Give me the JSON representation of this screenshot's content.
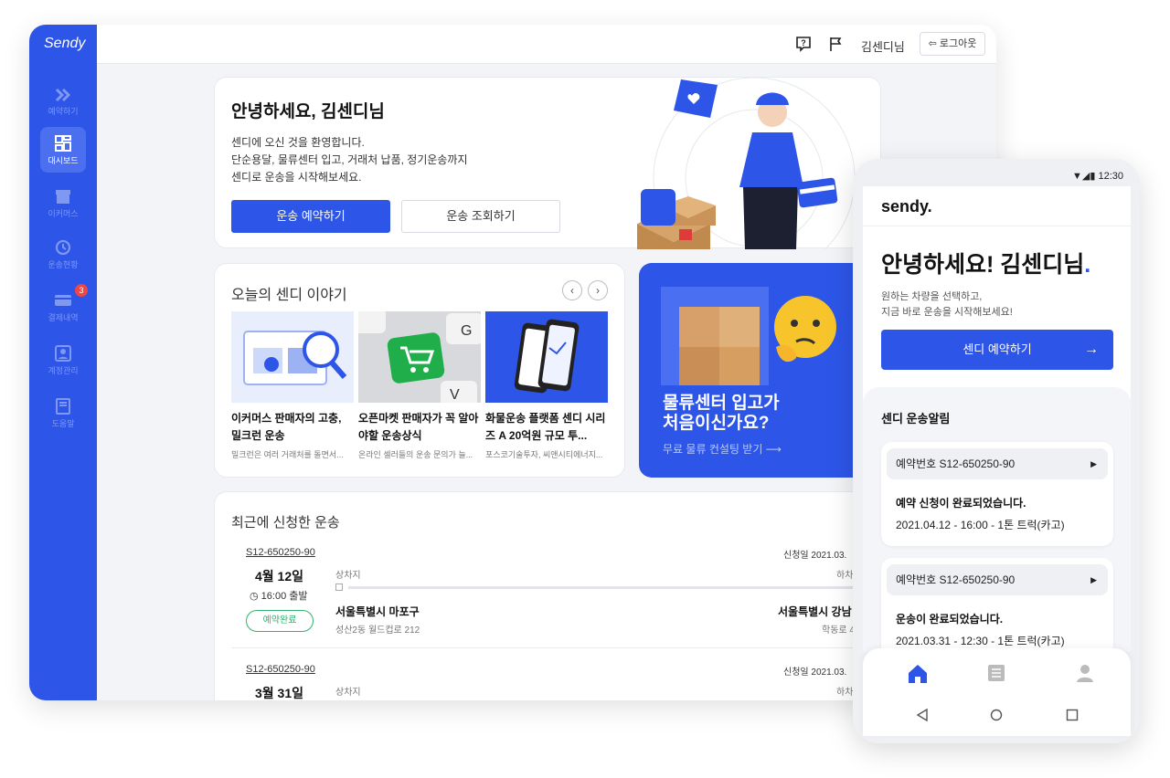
{
  "desktop": {
    "logo": "Sendy",
    "sidebar": [
      {
        "icon": "double-chevron-icon",
        "label": "예약하기",
        "active": false,
        "badge": ""
      },
      {
        "icon": "dashboard-icon",
        "label": "대시보드",
        "active": true,
        "badge": ""
      },
      {
        "icon": "store-icon",
        "label": "이커머스",
        "active": false,
        "badge": ""
      },
      {
        "icon": "history-icon",
        "label": "운송현황",
        "active": false,
        "badge": ""
      },
      {
        "icon": "card-icon",
        "label": "결제내역",
        "active": false,
        "badge": "3"
      },
      {
        "icon": "account-icon",
        "label": "계정관리",
        "active": false,
        "badge": ""
      },
      {
        "icon": "help-book-icon",
        "label": "도움말",
        "active": false,
        "badge": ""
      }
    ],
    "topbar": {
      "user": "김센디님",
      "logout": "로그아웃"
    },
    "hello": {
      "title": "안녕하세요, 김센디님",
      "line1": "센디에 오신 것을 환영합니다.",
      "line2": "단순용달, 물류센터 입고, 거래처 납품, 정기운송까지",
      "line3": "센디로 운송을 시작해보세요.",
      "primary": "운송 예약하기",
      "secondary": "운송 조회하기"
    },
    "story": {
      "title": "오늘의 센디 이야기",
      "items": [
        {
          "title": "이커머스 판매자의 고충, 밀크런 운송",
          "summary": "밀크런은 여러 거래처를 돌면서..."
        },
        {
          "title": "오픈마켓 판매자가 꼭 알아야할 운송상식",
          "summary": "온라인 셀러들의 운송 문의가 늘..."
        },
        {
          "title": "화물운송 플랫폼 센디 시리즈 A 20억원 규모 투...",
          "summary": "포스코기술투자, 씨앤시티에너지..."
        }
      ]
    },
    "promo": {
      "line1": "물류센터 입고가",
      "line2": "처음이신가요?",
      "link": "무료 물류 컨설팅 받기"
    },
    "recent": {
      "title": "최근에 신청한 운송",
      "rows": [
        {
          "id": "S12-650250-90",
          "date": "4월 12일",
          "time": "16:00 출발",
          "status": "예약완료",
          "applied": "신청일 2021.03.",
          "load_label": "상차지",
          "unload_label": "하차",
          "from": "서울특별시 마포구",
          "from_detail": "성산2동 월드컵로 212",
          "to": "서울특별시 강남",
          "to_detail": "학동로 4"
        },
        {
          "id": "S12-650250-90",
          "date": "3월 31일",
          "applied": "신청일 2021.03.",
          "load_label": "상차지",
          "unload_label": "하차"
        }
      ]
    }
  },
  "mobile": {
    "time": "12:30",
    "logo": "sendy.",
    "hello": "안녕하세요! 김센디님",
    "sub1": "원하는 차량을 선택하고,",
    "sub2": "지금 바로 운송을 시작해보세요!",
    "cta": "센디 예약하기",
    "alerts_title": "센디 운송알림",
    "alerts": [
      {
        "number": "예약번호 S12-650250-90",
        "message": "예약 신청이 완료되었습니다.",
        "detail": "2021.04.12 - 16:00 - 1톤 트럭(카고)"
      },
      {
        "number": "예약번호 S12-650250-90",
        "message": "운송이 완료되었습니다.",
        "detail": "2021.03.31 - 12:30 - 1톤 트럭(카고)"
      }
    ],
    "accent": "#2d55e8"
  }
}
